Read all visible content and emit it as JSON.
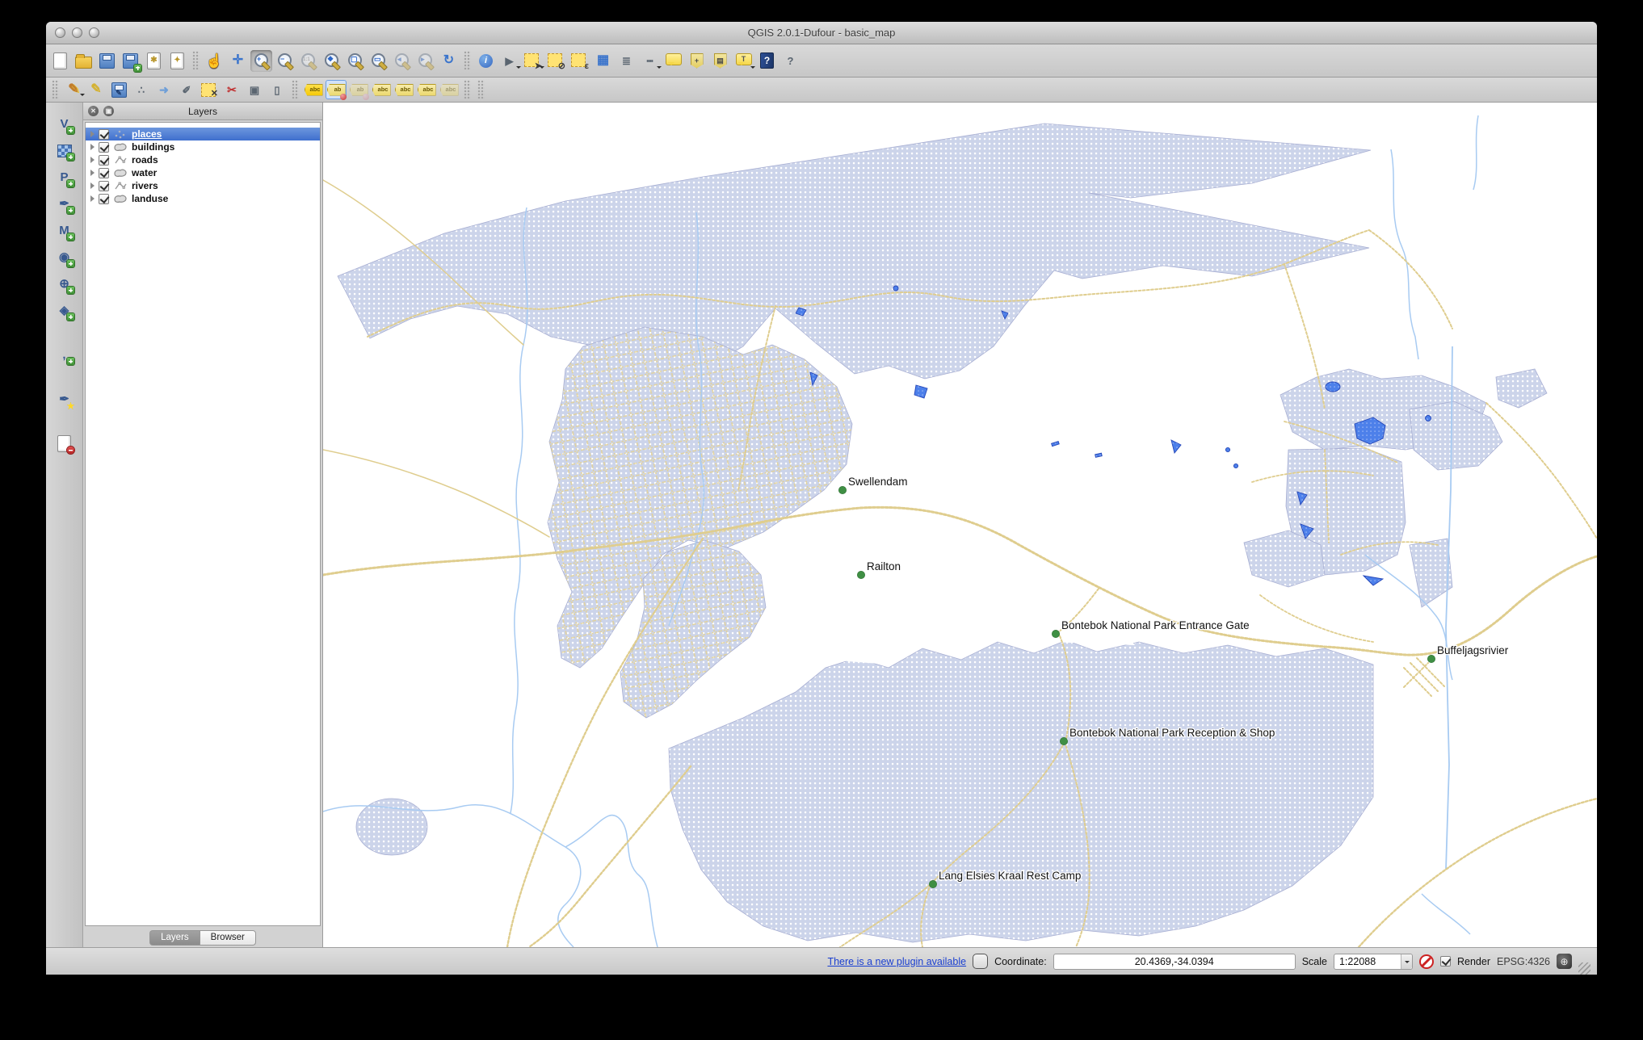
{
  "window": {
    "title": "QGIS 2.0.1-Dufour - basic_map"
  },
  "panel": {
    "title": "Layers",
    "close_glyph": "✕",
    "detach_glyph": "▣",
    "layers": [
      {
        "name": "places",
        "type": "point",
        "selected": true,
        "checked": true
      },
      {
        "name": "buildings",
        "type": "polygon",
        "selected": false,
        "checked": true
      },
      {
        "name": "roads",
        "type": "line",
        "selected": false,
        "checked": true
      },
      {
        "name": "water",
        "type": "polygon",
        "selected": false,
        "checked": true
      },
      {
        "name": "rivers",
        "type": "line",
        "selected": false,
        "checked": true
      },
      {
        "name": "landuse",
        "type": "polygon",
        "selected": false,
        "checked": true
      }
    ],
    "tabs": [
      {
        "label": "Layers",
        "active": true
      },
      {
        "label": "Browser",
        "active": false
      }
    ]
  },
  "toolbar1": [
    {
      "name": "new-project-icon",
      "cls": "c-page",
      "glyph": ""
    },
    {
      "name": "open-project-icon",
      "cls": "c-folder",
      "glyph": ""
    },
    {
      "name": "save-project-icon",
      "cls": "c-floppy",
      "glyph": ""
    },
    {
      "name": "save-project-as-icon",
      "cls": "c-floppy",
      "glyph": "",
      "badge": "plus"
    },
    {
      "name": "new-print-composer-icon",
      "cls": "c-page",
      "glyph": "✱"
    },
    {
      "name": "composer-manager-icon",
      "cls": "c-page",
      "glyph": "✦"
    },
    {
      "name": "toolbar-separator",
      "cls": "grip"
    },
    {
      "name": "pan-map-icon",
      "cls": "c-hand",
      "glyph": "☝"
    },
    {
      "name": "pan-to-selection-icon",
      "cls": "c-bluechar",
      "glyph": "✛"
    },
    {
      "name": "zoom-in-icon",
      "cls": "c-mag pressed",
      "glyph": "+"
    },
    {
      "name": "zoom-out-icon",
      "cls": "c-mag",
      "glyph": "−"
    },
    {
      "name": "zoom-native-icon",
      "cls": "c-mag dim",
      "glyph": "1:1",
      "small": true
    },
    {
      "name": "zoom-full-icon",
      "cls": "c-mag",
      "glyph": "❖"
    },
    {
      "name": "zoom-to-selection-icon",
      "cls": "c-mag",
      "glyph": "▢"
    },
    {
      "name": "zoom-to-layer-icon",
      "cls": "c-mag",
      "glyph": "▭"
    },
    {
      "name": "zoom-last-icon",
      "cls": "c-mag dim",
      "glyph": "◂"
    },
    {
      "name": "zoom-next-icon",
      "cls": "c-mag dim",
      "glyph": "▸"
    },
    {
      "name": "map-refresh-icon",
      "cls": "c-bluechar",
      "glyph": "↻"
    },
    {
      "name": "toolbar-separator",
      "cls": "grip"
    },
    {
      "name": "identify-features-icon",
      "cls": "c-infocircle",
      "glyph": "i"
    },
    {
      "name": "run-feature-action-icon",
      "cls": "c-graychar",
      "glyph": "▶",
      "caret": true
    },
    {
      "name": "select-features-icon",
      "cls": "c-selyellow",
      "glyph": "➤",
      "caret": true
    },
    {
      "name": "deselect-features-icon",
      "cls": "c-selyellow",
      "glyph": "⊘"
    },
    {
      "name": "select-by-expression-icon",
      "cls": "c-selyellow",
      "glyph": "ε"
    },
    {
      "name": "open-attribute-table-icon",
      "cls": "c-bluechar",
      "glyph": "▦"
    },
    {
      "name": "field-calculator-icon",
      "cls": "c-graychar",
      "glyph": "≣"
    },
    {
      "name": "measure-icon",
      "cls": "c-graychar",
      "glyph": "┉",
      "caret": true
    },
    {
      "name": "map-tips-icon",
      "cls": "c-bubble",
      "glyph": ""
    },
    {
      "name": "new-bookmark-icon",
      "cls": "c-tagplain",
      "glyph": "+"
    },
    {
      "name": "show-bookmarks-icon",
      "cls": "c-tagplain",
      "glyph": "▤"
    },
    {
      "name": "text-annotation-icon",
      "cls": "c-bubble",
      "glyph": "T",
      "caret": true
    },
    {
      "name": "help-icon",
      "cls": "c-helpbook",
      "glyph": "?"
    },
    {
      "name": "whats-this-icon",
      "cls": "c-graychar",
      "glyph": "?"
    }
  ],
  "toolbar2": [
    {
      "name": "toolbar-separator",
      "cls": "grip"
    },
    {
      "name": "current-edits-icon",
      "cls": "c-pencil2",
      "glyph": "✎",
      "caret": true
    },
    {
      "name": "toggle-editing-icon",
      "cls": "c-pencil",
      "glyph": "✎"
    },
    {
      "name": "save-layer-edits-icon",
      "cls": "c-floppy",
      "glyph": "✎"
    },
    {
      "name": "add-feature-icon",
      "cls": "c-graychar",
      "glyph": "∴"
    },
    {
      "name": "move-feature-icon",
      "cls": "c-polychar",
      "glyph": "➜"
    },
    {
      "name": "node-tool-icon",
      "cls": "c-graychar",
      "glyph": "✐"
    },
    {
      "name": "delete-selected-icon",
      "cls": "c-selyellow",
      "glyph": "✕"
    },
    {
      "name": "cut-features-icon",
      "cls": "c-redchar",
      "glyph": "✂"
    },
    {
      "name": "copy-features-icon",
      "cls": "c-graychar",
      "glyph": "▣"
    },
    {
      "name": "paste-features-icon",
      "cls": "c-graychar",
      "glyph": "▯"
    },
    {
      "name": "toolbar-separator",
      "cls": "grip"
    },
    {
      "name": "labeling-options-icon",
      "cls": "c-tag c-tag-hot",
      "glyph": "abc"
    },
    {
      "name": "pin-unpin-labels-icon",
      "cls": "c-tag tool-active",
      "glyph": "ab",
      "pin": "red"
    },
    {
      "name": "highlight-pinned-labels-icon",
      "cls": "c-tag dim",
      "glyph": "ab",
      "pin": "pink"
    },
    {
      "name": "show-hide-labels-icon",
      "cls": "c-tag",
      "glyph": "abc"
    },
    {
      "name": "move-label-icon",
      "cls": "c-tag",
      "glyph": "abc"
    },
    {
      "name": "rotate-label-icon",
      "cls": "c-tag",
      "glyph": "abc"
    },
    {
      "name": "change-label-icon",
      "cls": "c-tag dim",
      "glyph": "abc"
    },
    {
      "name": "toolbar-separator",
      "cls": "grip"
    },
    {
      "name": "toolbar-separator",
      "cls": "grip"
    }
  ],
  "lefttoolbar": [
    {
      "name": "add-vector-layer-icon",
      "cls": "c-chip",
      "glyph": "V",
      "badge": "plus"
    },
    {
      "name": "add-raster-layer-icon",
      "cls": "c-checker",
      "glyph": "",
      "badge": "plus"
    },
    {
      "name": "add-postgis-layer-icon",
      "cls": "c-chip",
      "glyph": "P",
      "badge": "plus"
    },
    {
      "name": "add-spatialite-layer-icon",
      "cls": "c-chip",
      "glyph": "✒",
      "badge": "plus"
    },
    {
      "name": "add-mssql-layer-icon",
      "cls": "c-chip",
      "glyph": "M",
      "badge": "plus"
    },
    {
      "name": "add-oracle-layer-icon",
      "cls": "c-chip",
      "glyph": "◉",
      "badge": "plus"
    },
    {
      "name": "add-wms-layer-icon",
      "cls": "c-chip",
      "glyph": "⊕",
      "badge": "plus"
    },
    {
      "name": "add-wfs-layer-icon",
      "cls": "c-chip",
      "glyph": "◈",
      "badge": "plus"
    },
    {
      "name": "add-delimited-text-layer-icon",
      "cls": "c-chip gap-top",
      "glyph": ",",
      "badge": "plus"
    },
    {
      "name": "new-spatialite-layer-icon",
      "cls": "c-chip gap-top",
      "glyph": "✒",
      "badge": "star"
    },
    {
      "name": "remove-layer-icon",
      "cls": "c-page gap-top",
      "glyph": "",
      "badge": "minus"
    }
  ],
  "map": {
    "labels": [
      {
        "text": "Swellendam"
      },
      {
        "text": "Railton"
      },
      {
        "text": "Bontebok National Park Entrance Gate"
      },
      {
        "text": "Buffeljagsrivier"
      },
      {
        "text": "Bontebok National Park Reception & Shop"
      },
      {
        "text": "Lang Elsies Kraal Rest Camp"
      }
    ]
  },
  "status": {
    "plugin_link": "There is a new plugin available",
    "coordinate_label": "Coordinate:",
    "coordinate_value": "20.4369,-34.0394",
    "scale_label": "Scale",
    "scale_value": "1:22088",
    "render_label": "Render",
    "crs": "EPSG:4326",
    "crs_icon_glyph": "⊕"
  },
  "colors": {
    "selection_blue": "#3f6fce",
    "landuse_fill": "#ccd4ea",
    "road_yellow": "#dfcd8e",
    "river_blue": "#a8cbf2",
    "water_blue": "#4d80ea",
    "place_green": "#3f8f44",
    "link_blue": "#1a3fd1"
  }
}
